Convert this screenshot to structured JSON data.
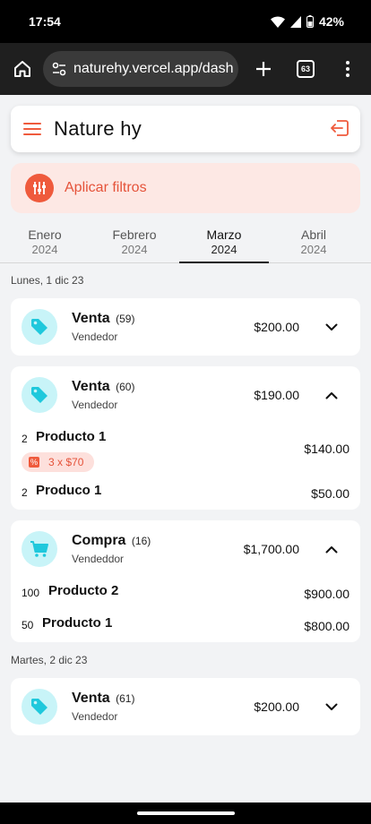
{
  "status_bar": {
    "time": "17:54",
    "battery": "42%"
  },
  "browser": {
    "url": "naturehy.vercel.app/dash",
    "tab_count": "63"
  },
  "app": {
    "brand": "Nature hy",
    "filters_label": "Aplicar filtros"
  },
  "months": [
    {
      "name": "Enero",
      "year": "2024"
    },
    {
      "name": "Febrero",
      "year": "2024"
    },
    {
      "name": "Marzo",
      "year": "2024"
    },
    {
      "name": "Abril",
      "year": "2024"
    }
  ],
  "active_month": "Marzo",
  "days": [
    {
      "label": "Lunes, 1 dic 23"
    },
    {
      "label": "Martes, 2 dic 23"
    }
  ],
  "transactions": [
    {
      "type": "Venta",
      "number": "(59)",
      "subtitle": "Vendedor",
      "amount": "$200.00",
      "icon": "tag-icon",
      "expanded": false,
      "items": []
    },
    {
      "type": "Venta",
      "number": "(60)",
      "subtitle": "Vendedor",
      "amount": "$190.00",
      "icon": "tag-icon",
      "expanded": true,
      "items": [
        {
          "qty": "2",
          "name": "Producto 1",
          "price": "$140.00",
          "promo": "3 x $70"
        },
        {
          "qty": "2",
          "name": "Produco 1",
          "price": "$50.00"
        }
      ]
    },
    {
      "type": "Compra",
      "number": "(16)",
      "subtitle": "Vendeddor",
      "amount": "$1,700.00",
      "icon": "cart-icon",
      "expanded": true,
      "items": [
        {
          "qty": "100",
          "name": "Producto 2",
          "price": "$900.00"
        },
        {
          "qty": "50",
          "name": "Producto 1",
          "price": "$800.00"
        }
      ]
    },
    {
      "type": "Venta",
      "number": "(61)",
      "subtitle": "Vendedor",
      "amount": "$200.00",
      "icon": "tag-icon",
      "expanded": false,
      "items": []
    }
  ],
  "colors": {
    "accent": "#ef5a3c",
    "icon_bg": "#c8f4f8",
    "icon_fg": "#1fc8dc",
    "filters_bg": "#fde8e4"
  }
}
